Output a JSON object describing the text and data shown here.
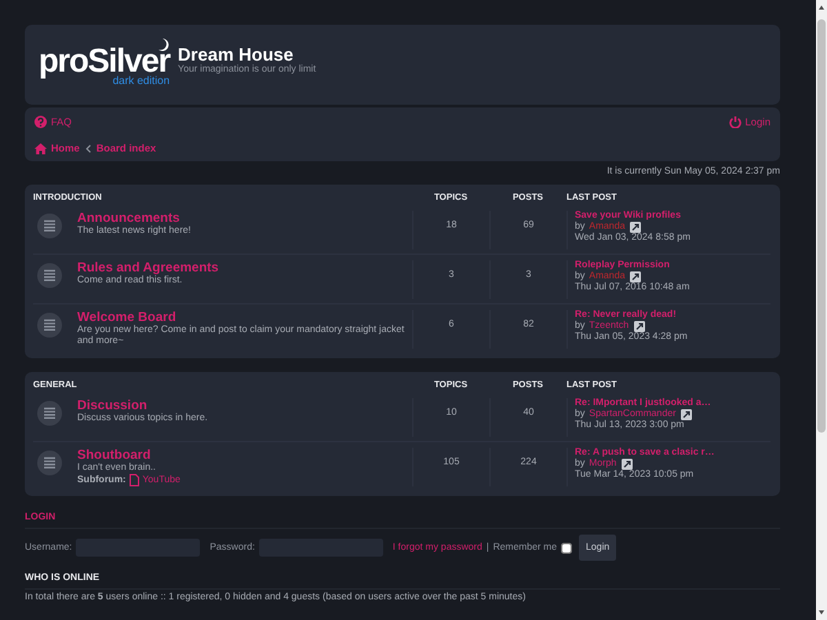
{
  "header": {
    "logo_word": "proSilver",
    "logo_sub": "dark edition",
    "site_title": "Dream House",
    "site_description": "Your imagination is our only limit"
  },
  "navbar": {
    "faq": "FAQ",
    "login": "Login",
    "breadcrumbs": [
      "Home",
      "Board index"
    ]
  },
  "current_time": "It is currently Sun May 05, 2024 2:37 pm",
  "categories": [
    {
      "name": "INTRODUCTION",
      "columns": [
        "TOPICS",
        "POSTS",
        "LAST POST"
      ],
      "forums": [
        {
          "title": "Announcements",
          "description": "The latest news right here!",
          "topics": "18",
          "posts": "69",
          "last_post": {
            "title": "Save your Wiki profiles",
            "by": "by",
            "author": "Amanda",
            "color": "#c0272d",
            "date": "Wed Jan 03, 2024 8:58 pm"
          }
        },
        {
          "title": "Rules and Agreements",
          "description": "Come and read this first.",
          "topics": "3",
          "posts": "3",
          "last_post": {
            "title": "Roleplay Permission",
            "by": "by",
            "author": "Amanda",
            "color": "#c0272d",
            "date": "Thu Jul 07, 2016 10:48 am"
          }
        },
        {
          "title": "Welcome Board",
          "description": "Are you new here? Come in and post to claim your mandatory straight jacket and more~",
          "topics": "6",
          "posts": "82",
          "last_post": {
            "title": "Re: Never really dead!",
            "by": "by",
            "author": "Tzeentch",
            "color": "#d31f6b",
            "date": "Thu Jan 05, 2023 4:28 pm"
          }
        }
      ]
    },
    {
      "name": "GENERAL",
      "columns": [
        "TOPICS",
        "POSTS",
        "LAST POST"
      ],
      "forums": [
        {
          "title": "Discussion",
          "description": "Discuss various topics in here.",
          "topics": "10",
          "posts": "40",
          "last_post": {
            "title": "Re: IMportant I justlooked a…",
            "by": "by",
            "author": "SpartanCommander",
            "color": "#d31f6b",
            "date": "Thu Jul 13, 2023 3:00 pm"
          }
        },
        {
          "title": "Shoutboard",
          "description": "I can't even brain..",
          "subforum": {
            "label": "Subforum:",
            "link": "YouTube"
          },
          "topics": "105",
          "posts": "224",
          "last_post": {
            "title": "Re: A push to save a clasic r…",
            "by": "by",
            "author": "Morph",
            "color": "#d31f6b",
            "date": "Tue Mar 14, 2023 10:05 pm"
          }
        }
      ]
    }
  ],
  "login": {
    "heading": "LOGIN",
    "username_label": "Username:",
    "password_label": "Password:",
    "forgot": "I forgot my password",
    "separator": "|",
    "remember": "Remember me",
    "remember_checked": false,
    "button": "Login"
  },
  "who_is_online": {
    "heading": "WHO IS ONLINE",
    "text": "In total there are **5** users online :: 1 registered, 0 hidden and 4 guests (based on users active over the past 5 minutes)"
  }
}
